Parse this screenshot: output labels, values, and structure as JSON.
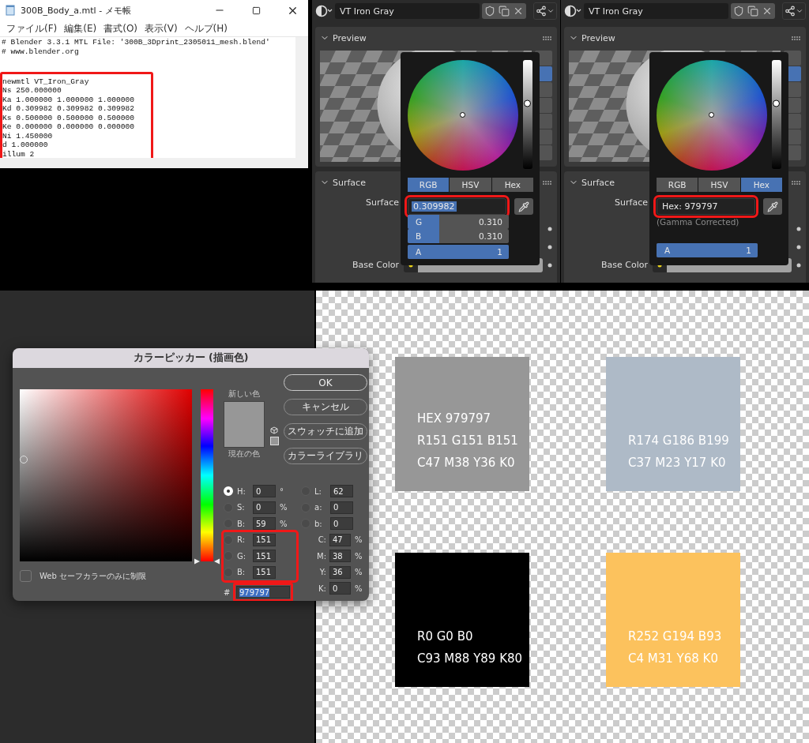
{
  "notepad": {
    "title": "300B_Body_a.mtl - メモ帳",
    "menu": [
      "ファイル(F)",
      "編集(E)",
      "書式(O)",
      "表示(V)",
      "ヘルプ(H)"
    ],
    "header_lines": [
      "# Blender 3.3.1 MTL File: '300B_3Dprint_2305011_mesh.blend'",
      "# www.blender.org"
    ],
    "material_block": {
      "highlighted": true,
      "lines": [
        "newmtl VT_Iron_Gray",
        "Ns 250.000000",
        "Ka 1.000000 1.000000 1.000000",
        "Kd 0.309982 0.309982 0.309982",
        "Ks 0.500000 0.500000 0.500000",
        "Ke 0.000000 0.000000 0.000000",
        "Ni 1.450000",
        "d 1.000000",
        "illum 2"
      ]
    }
  },
  "blender_panels": [
    {
      "material": "VT Iron Gray",
      "preview_heading": "Preview",
      "surface_heading": "Surface",
      "surface_label": "Surface",
      "base_color_label": "Base Color",
      "preview_tools": [
        {
          "selected": false
        },
        {
          "selected": true
        },
        {
          "selected": false
        },
        {
          "selected": false
        },
        {
          "selected": false
        },
        {
          "selected": false
        },
        {
          "selected": false
        }
      ],
      "picker": {
        "value_slider": {
          "level": 0.6
        },
        "tabs": [
          {
            "label": "RGB",
            "selected": true
          },
          {
            "label": "HSV",
            "selected": false
          },
          {
            "label": "Hex",
            "selected": false
          }
        ],
        "input": {
          "value": "0.309982",
          "text_selected": true,
          "highlighted": true
        },
        "channels": [
          {
            "label": "G",
            "value": "0.310",
            "level": 0.31
          },
          {
            "label": "B",
            "value": "0.310",
            "level": 0.31
          },
          {
            "label": "A",
            "value": "1",
            "level": 1
          }
        ]
      }
    },
    {
      "material": "VT Iron Gray",
      "preview_heading": "Preview",
      "surface_heading": "Surface",
      "surface_label": "Surface",
      "base_color_label": "Base Color",
      "preview_tools": [
        {
          "selected": false
        },
        {
          "selected": true
        },
        {
          "selected": false
        },
        {
          "selected": false
        },
        {
          "selected": false
        },
        {
          "selected": false
        },
        {
          "selected": false
        }
      ],
      "picker": {
        "value_slider": {
          "level": 0.6
        },
        "tabs": [
          {
            "label": "RGB",
            "selected": false
          },
          {
            "label": "HSV",
            "selected": false
          },
          {
            "label": "Hex",
            "selected": true
          }
        ],
        "input": {
          "value": "Hex: 979797",
          "text_selected": false,
          "highlighted": true
        },
        "note": "(Gamma Corrected)",
        "channels": [
          {
            "label": "A",
            "value": "1",
            "level": 1
          }
        ]
      }
    }
  ],
  "color_picker_dialog": {
    "title": "カラーピッカー (描画色)",
    "buttons": [
      {
        "label": "OK",
        "default": true
      },
      {
        "label": "キャンセル",
        "default": false
      },
      {
        "label": "スウォッチに追加",
        "default": false
      },
      {
        "label": "カラーライブラリ",
        "default": false
      }
    ],
    "hue_slider": {
      "level": 0
    },
    "new_label": "新しい色",
    "current_label": "現在の色",
    "web_safe": {
      "label": "Web セーフカラーのみに制限",
      "checked": false
    },
    "hsb_fields": [
      {
        "label": "H:",
        "value": "0",
        "unit": "°",
        "selected": true
      },
      {
        "label": "S:",
        "value": "0",
        "unit": "%",
        "selected": false
      },
      {
        "label": "B:",
        "value": "59",
        "unit": "%",
        "selected": false
      }
    ],
    "rgb_group": {
      "highlighted": true,
      "fields": [
        {
          "label": "R:",
          "value": "151",
          "selected": false
        },
        {
          "label": "G:",
          "value": "151",
          "selected": false
        },
        {
          "label": "B:",
          "value": "151",
          "selected": false
        }
      ]
    },
    "hex": {
      "label": "#",
      "value": "979797",
      "text_selected": true,
      "highlighted": true
    },
    "lab_fields": [
      {
        "label": "L:",
        "value": "62",
        "selected": false
      },
      {
        "label": "a:",
        "value": "0",
        "selected": false
      },
      {
        "label": "b:",
        "value": "0",
        "selected": false
      }
    ],
    "cmyk_fields": [
      {
        "label": "C:",
        "value": "47",
        "unit": "%"
      },
      {
        "label": "M:",
        "value": "38",
        "unit": "%"
      },
      {
        "label": "Y:",
        "value": "36",
        "unit": "%"
      },
      {
        "label": "K:",
        "value": "0",
        "unit": "%"
      }
    ]
  },
  "swatches": [
    {
      "color": "#979797",
      "lines": [
        "HEX 979797",
        "R151 G151 B151",
        "C47 M38 Y36 K0"
      ]
    },
    {
      "color": "#aebac7",
      "lines": [
        "R174 G186 B199",
        "C37 M23 Y17 K0"
      ]
    },
    {
      "color": "#000000",
      "lines": [
        "R0 G0 B0",
        "C93 M88 Y89 K80"
      ]
    },
    {
      "color": "#fcc25d",
      "lines": [
        "R252 G194 B93",
        "C4 M31 Y68 K0"
      ]
    }
  ]
}
